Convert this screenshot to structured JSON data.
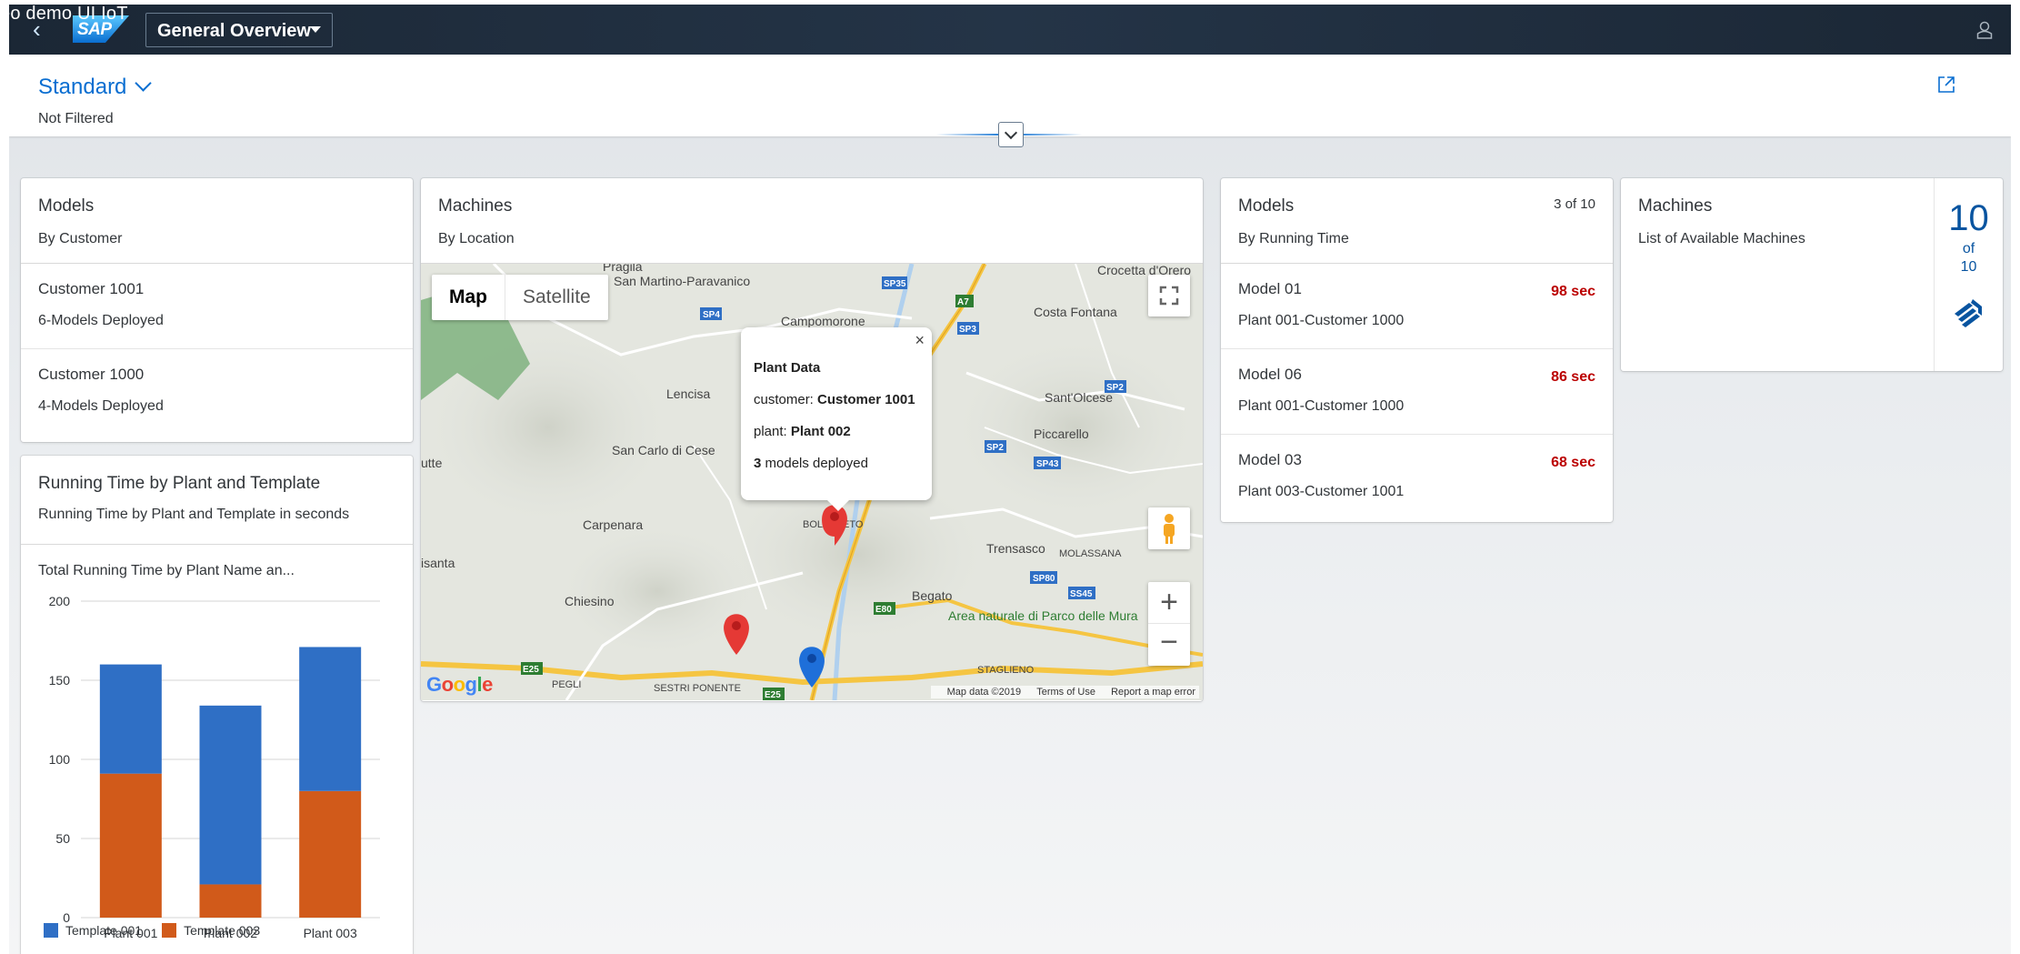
{
  "overlay_caption": "eo demo UI IoT",
  "shell": {
    "logo": "SAP",
    "view_title": "General Overview"
  },
  "filter": {
    "variant": "Standard",
    "status": "Not Filtered"
  },
  "models_by_customer": {
    "title": "Models",
    "subtitle": "By Customer",
    "items": [
      {
        "title": "Customer 1001",
        "desc": "6-Models Deployed"
      },
      {
        "title": "Customer 1000",
        "desc": "4-Models Deployed"
      }
    ]
  },
  "machines_map": {
    "title": "Machines",
    "subtitle": "By Location",
    "toggle": {
      "map": "Map",
      "satellite": "Satellite"
    },
    "popup": {
      "title": "Plant Data",
      "customer_label": "customer:",
      "customer_value": "Customer 1001",
      "plant_label": "plant:",
      "plant_value": "Plant 002",
      "models_count": "3",
      "models_text": "models deployed"
    },
    "place_labels": [
      "Pragila",
      "San Martino-Paravanico",
      "Campomorone",
      "Crocetta d'Orero",
      "Costa Fontana",
      "Lencisa",
      "Sant'Olcese",
      "Piccarello",
      "San Carlo di Cese",
      "Carpenara",
      "Trensasco",
      "MOLASSANA",
      "Chiesino",
      "Begato",
      "Area naturale di Parco delle Mura",
      "STAGLIENO",
      "SESTRI PONENTE",
      "PEGLI",
      "isanta",
      "utte",
      "BOLZANETO"
    ],
    "road_labels": [
      "SP35",
      "SP4",
      "A7",
      "SP3",
      "SP2",
      "SP2",
      "SP43",
      "SP80",
      "SS45",
      "E80",
      "E25",
      "E25"
    ],
    "footer": {
      "data": "Map data ©2019",
      "terms": "Terms of Use",
      "report": "Report a map error"
    },
    "google": "Google",
    "marker_colors": {
      "red": "#e53935",
      "blue": "#1e6fd9"
    }
  },
  "models_by_time": {
    "title": "Models",
    "subtitle": "By Running Time",
    "count": "3 of 10",
    "items": [
      {
        "title": "Model 01",
        "desc": "Plant 001-Customer 1000",
        "value": "98 sec"
      },
      {
        "title": "Model 06",
        "desc": "Plant 001-Customer 1000",
        "value": "86 sec"
      },
      {
        "title": "Model 03",
        "desc": "Plant 003-Customer 1001",
        "value": "68 sec"
      }
    ]
  },
  "machines_kpi": {
    "title": "Machines",
    "subtitle": "List of Available Machines",
    "value": "10",
    "of_label": "of",
    "total": "10"
  },
  "running_time_card": {
    "title": "Running Time by Plant and Template",
    "subtitle": "Running Time by Plant and Template in seconds",
    "chart_title": "Total Running Time by Plant Name an..."
  },
  "chart_data": {
    "type": "bar",
    "stacked": true,
    "categories": [
      "Plant 001",
      "Plant 002",
      "Plant 003"
    ],
    "series": [
      {
        "name": "Template 003",
        "color": "#d15a1a",
        "values": [
          91,
          21,
          80
        ]
      },
      {
        "name": "Template 001",
        "color": "#2f6fc5",
        "values": [
          69,
          113,
          91
        ]
      }
    ],
    "legend_order": [
      "Template 001",
      "Template 003"
    ],
    "yticks": [
      0,
      50,
      100,
      150,
      200
    ],
    "ylim": [
      0,
      200
    ],
    "grid": true,
    "legend": "bottom-left"
  }
}
